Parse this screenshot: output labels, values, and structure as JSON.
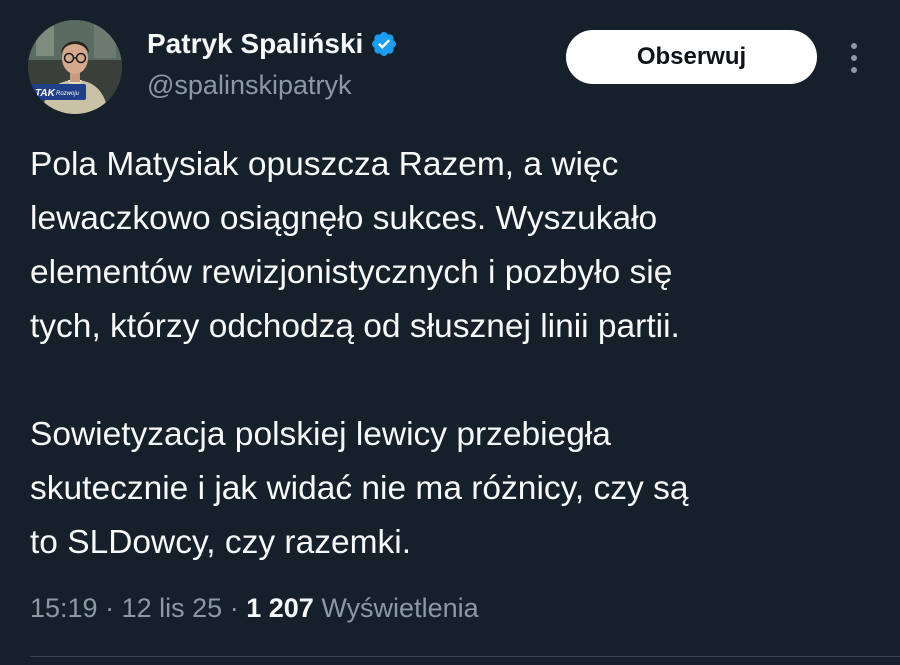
{
  "author": {
    "display_name": "Patryk Spaliński",
    "handle": "@spalinskipatryk",
    "avatar_caption": "TAK Rozwoju",
    "verified": true,
    "verified_color": "#1d9bf0"
  },
  "actions": {
    "follow_label": "Obserwuj",
    "more_icon": "more-vertical-icon"
  },
  "tweet": {
    "paragraph_1_lines": [
      "Pola Matysiak opuszcza Razem, a więc",
      "lewaczkowo osiągnęło sukces. Wyszukało",
      "elementów rewizjonistycznych i pozbyło się",
      "tych, którzy odchodzą od słusznej linii partii."
    ],
    "paragraph_2_lines": [
      "Sowietyzacja polskiej lewicy przebiegła",
      "skutecznie i jak widać nie ma różnicy, czy są",
      "to SLDowcy, czy razemki."
    ]
  },
  "meta": {
    "time": "15:19",
    "separator": "·",
    "date": "12 lis 25",
    "views_count": "1 207",
    "views_label": "Wyświetlenia"
  },
  "colors": {
    "background": "#15202b",
    "primary_text": "#f7f9f9",
    "secondary_text": "#8b98a5",
    "button_bg": "#ffffff",
    "button_text": "#0f1419"
  }
}
